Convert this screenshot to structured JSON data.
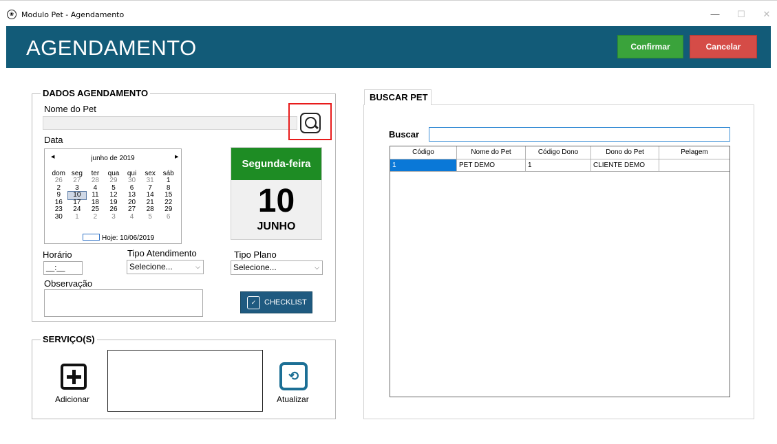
{
  "window": {
    "app_icon": "paw-icon",
    "title": "Modulo Pet - Agendamento",
    "minimize": "—",
    "maximize": "☐",
    "close": "✕"
  },
  "header": {
    "title": "AGENDAMENTO",
    "confirm_label": "Confirmar",
    "cancel_label": "Cancelar",
    "colors": {
      "bar": "#125b78",
      "confirm": "#3aa33b",
      "cancel": "#d54c47"
    }
  },
  "dados": {
    "legend": "DADOS AGENDAMENTO",
    "nome_pet_label": "Nome do Pet",
    "nome_pet_value": "",
    "search_icon": "magnifier-icon",
    "data_label": "Data",
    "calendar": {
      "month_title": "junho de 2019",
      "prev": "◀",
      "next": "▶",
      "days_of_week": [
        "dom",
        "seg",
        "ter",
        "qua",
        "qui",
        "sex",
        "sáb"
      ],
      "weeks": [
        [
          {
            "d": "26",
            "o": true
          },
          {
            "d": "27",
            "o": true
          },
          {
            "d": "28",
            "o": true
          },
          {
            "d": "29",
            "o": true
          },
          {
            "d": "30",
            "o": true
          },
          {
            "d": "31",
            "o": true
          },
          {
            "d": "1"
          }
        ],
        [
          {
            "d": "2"
          },
          {
            "d": "3"
          },
          {
            "d": "4"
          },
          {
            "d": "5"
          },
          {
            "d": "6"
          },
          {
            "d": "7"
          },
          {
            "d": "8"
          }
        ],
        [
          {
            "d": "9"
          },
          {
            "d": "10",
            "s": true
          },
          {
            "d": "11"
          },
          {
            "d": "12"
          },
          {
            "d": "13"
          },
          {
            "d": "14"
          },
          {
            "d": "15"
          }
        ],
        [
          {
            "d": "16"
          },
          {
            "d": "17"
          },
          {
            "d": "18"
          },
          {
            "d": "19"
          },
          {
            "d": "20"
          },
          {
            "d": "21"
          },
          {
            "d": "22"
          }
        ],
        [
          {
            "d": "23"
          },
          {
            "d": "24"
          },
          {
            "d": "25"
          },
          {
            "d": "26"
          },
          {
            "d": "27"
          },
          {
            "d": "28"
          },
          {
            "d": "29"
          }
        ],
        [
          {
            "d": "30"
          },
          {
            "d": "1",
            "o": true
          },
          {
            "d": "2",
            "o": true
          },
          {
            "d": "3",
            "o": true
          },
          {
            "d": "4",
            "o": true
          },
          {
            "d": "5",
            "o": true
          },
          {
            "d": "6",
            "o": true
          }
        ]
      ],
      "today_text": "Hoje: 10/06/2019"
    },
    "date_card": {
      "day_name": "Segunda-feira",
      "day_number": "10",
      "month": "JUNHO"
    },
    "horario_label": "Horário",
    "horario_value": "__:__",
    "tipo_atendimento_label": "Tipo Atendimento",
    "tipo_atendimento_value": "Selecione...",
    "tipo_plano_label": "Tipo Plano",
    "tipo_plano_value": "Selecione...",
    "observacao_label": "Observação",
    "observacao_value": "",
    "checklist_label": "CHECKLIST",
    "checklist_icon": "checklist-icon"
  },
  "servicos": {
    "legend": "SERVIÇO(S)",
    "add_label": "Adicionar",
    "add_icon": "plus-square-icon",
    "update_label": "Atualizar",
    "update_icon": "refresh-icon",
    "update_glyph": "⟲"
  },
  "buscar_pet": {
    "tab_label": "BUSCAR PET",
    "search_label": "Buscar",
    "search_value": "",
    "columns": [
      "Código",
      "Nome do Pet",
      "Código Dono",
      "Dono do Pet",
      "Pelagem"
    ],
    "rows": [
      [
        "1",
        "PET DEMO",
        "1",
        "CLIENTE DEMO",
        ""
      ]
    ]
  }
}
